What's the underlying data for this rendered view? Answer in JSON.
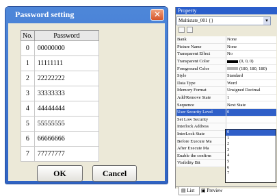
{
  "dialog": {
    "title": "Password setting",
    "close_glyph": "✕",
    "columns": [
      "No.",
      "Password"
    ],
    "rows": [
      {
        "no": "0",
        "password": "00000000"
      },
      {
        "no": "1",
        "password": "11111111"
      },
      {
        "no": "2",
        "password": "22222222"
      },
      {
        "no": "3",
        "password": "33333333"
      },
      {
        "no": "4",
        "password": "44444444"
      },
      {
        "no": "5",
        "password": "55555555"
      },
      {
        "no": "6",
        "password": "66666666"
      },
      {
        "no": "7",
        "password": "77777777"
      }
    ],
    "ok_label": "OK",
    "cancel_label": "Cancel"
  },
  "property": {
    "title": "Property",
    "object": "Multistate_001 {}",
    "rows": [
      {
        "key": "Bank",
        "value": "None"
      },
      {
        "key": "Picture Name",
        "value": "None"
      },
      {
        "key": "Transparent Effect",
        "value": "No"
      },
      {
        "key": "Transparent Color",
        "value": "(0, 0, 0)"
      },
      {
        "key": "Foreground Color",
        "value": "(180, 180, 180)"
      },
      {
        "key": "Style",
        "value": "Standard"
      },
      {
        "key": "Data Type",
        "value": "Word"
      },
      {
        "key": "Memory Format",
        "value": "Unsigned Decimal"
      },
      {
        "key": "Add/Remove State",
        "value": "1"
      },
      {
        "key": "Sequence",
        "value": "Next State"
      },
      {
        "key": "User Security Level",
        "value": "0"
      },
      {
        "key": "Set Low Security",
        "value": ""
      },
      {
        "key": "Interlock Address",
        "value": ""
      },
      {
        "key": "InterLock State",
        "value": ""
      },
      {
        "key": "Before Execute Ma",
        "value": ""
      },
      {
        "key": "After Execute Ma",
        "value": ""
      },
      {
        "key": "Enable the confirm",
        "value": ""
      },
      {
        "key": "Visibility Bit",
        "value": "None"
      }
    ],
    "dropdown_options": [
      "0",
      "1",
      "2",
      "3",
      "4",
      "5",
      "6",
      "7"
    ],
    "tabs": [
      "List",
      "Preview"
    ],
    "colors": {
      "transparent": "#000000",
      "foreground": "#b4b4b4"
    }
  }
}
